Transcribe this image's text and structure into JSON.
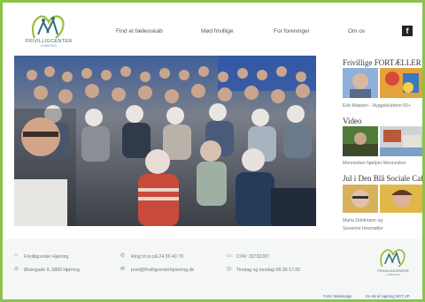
{
  "header": {
    "logo_text": "FRIVILLIGCENTER",
    "logo_subtext": "HJØRRING",
    "nav": [
      "Find et fællesskab",
      "Mød frivillige",
      "For foreninger",
      "Om os"
    ],
    "facebook_icon": "facebook-icon",
    "facebook_glyph": "f"
  },
  "sidebar": {
    "section1_title": "Frivillige FORTÆLLER",
    "section1_caption": "Erik Madsen - Hyggeklubben 65+",
    "section2_title": "Video",
    "section2_caption": "Mennesker hjælper Mennesker",
    "section3_title": "Jul i Den Blå Sociale Café",
    "section3_caption_line1": "Maria Dahlmann og",
    "section3_caption_line2": "Susanne Houmøller"
  },
  "footer": {
    "org_name": "Frivilligcenter Hjørring",
    "address": "Østergade 9, 9800 Hjørring",
    "phone": "Ring til os på 24 26 40 70",
    "email": "post@frivilligcenterhjoerring.dk",
    "cvr": "CVR: 33732287",
    "hours": "Tirsdag og torsdag 08.30-17.00",
    "credit_left": "Fortic Webdesign",
    "credit_right": "En del af Hjørring NOT UP",
    "logo_text": "FRIVILLIGCENTER",
    "logo_subtext": "HJØRRING"
  },
  "colors": {
    "border": "#8bc34a",
    "brand_teal": "#2f6f7a",
    "link": "#2e6fa0"
  }
}
